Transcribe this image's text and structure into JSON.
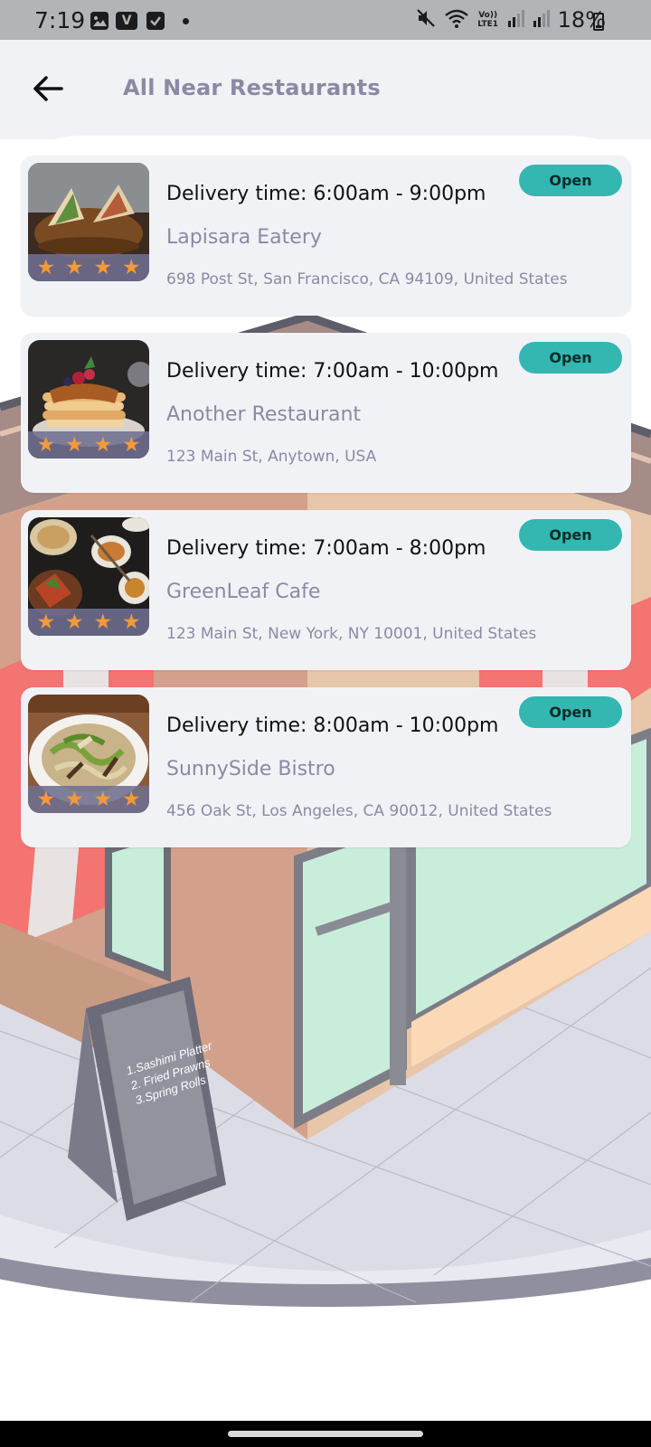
{
  "status_bar": {
    "time": "7:19",
    "notification_icons": [
      "gallery-icon",
      "v-app-icon",
      "check-app-icon"
    ],
    "volte_label": "Vo)) LTE1",
    "battery_percent": "18%"
  },
  "header": {
    "title": "All Near Restaurants"
  },
  "illustration": {
    "sign_lines": [
      "1.Sashimi Platter",
      "2. Fried Prawns",
      "3.Spring Rolls"
    ]
  },
  "restaurants": [
    {
      "delivery_time": "Delivery time: 6:00am - 9:00pm",
      "name": "Lapisara Eatery",
      "address": "698 Post St, San Francisco, CA 94109, United States",
      "status": "Open",
      "rating": 4,
      "image": "sandwich-photo"
    },
    {
      "delivery_time": "Delivery time: 7:00am - 10:00pm",
      "name": "Another Restaurant",
      "address": "123 Main St, Anytown, USA",
      "status": "Open",
      "rating": 4,
      "image": "pancakes-photo"
    },
    {
      "delivery_time": "Delivery time: 7:00am - 8:00pm",
      "name": "GreenLeaf Cafe",
      "address": "123 Main St, New York, NY 10001, United States",
      "status": "Open",
      "rating": 4,
      "image": "noodle-dishes-photo"
    },
    {
      "delivery_time": "Delivery time: 8:00am - 10:00pm",
      "name": "SunnySide Bistro",
      "address": "456 Oak St, Los Angeles, CA 90012, United States",
      "status": "Open",
      "rating": 4,
      "image": "stir-fry-photo"
    }
  ],
  "colors": {
    "accent_open": "#33b7b0",
    "star": "#f39a3a",
    "muted_text": "#8a8aa3",
    "card_bg": "#f1f2f6"
  }
}
